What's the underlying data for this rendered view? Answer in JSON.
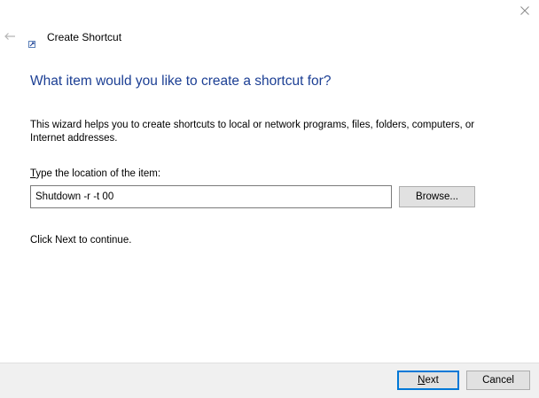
{
  "window": {
    "title": "Create Shortcut",
    "close_icon": "close-icon",
    "back_icon": "back-arrow-icon",
    "app_icon": "shortcut-app-icon"
  },
  "main": {
    "heading": "What item would you like to create a shortcut for?",
    "description": "This wizard helps you to create shortcuts to local or network programs, files, folders, computers, or Internet addresses.",
    "location_label_mnemonic": "T",
    "location_label_rest": "ype the location of the item:",
    "location_value": "Shutdown -r -t 00",
    "browse_label": "Browse...",
    "continue_text": "Click Next to continue."
  },
  "footer": {
    "next_mnemonic": "N",
    "next_rest": "ext",
    "cancel_label": "Cancel"
  },
  "colors": {
    "heading": "#1c3f94",
    "accent": "#0078d7",
    "footer_bg": "#f0f0f0",
    "button_bg": "#e1e1e1"
  }
}
